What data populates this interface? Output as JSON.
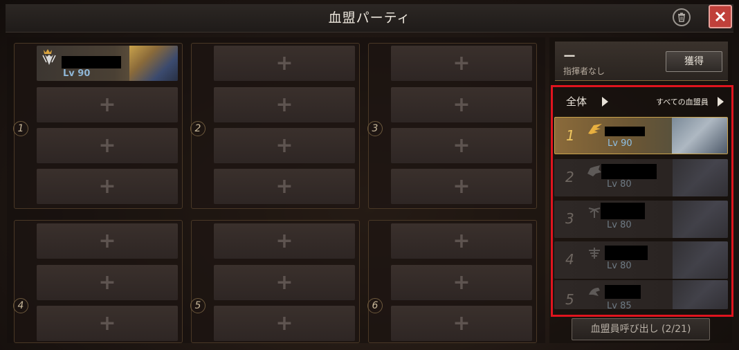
{
  "window": {
    "title": "血盟パーティ"
  },
  "parties": [
    {
      "number": "1",
      "slots": [
        {
          "filled": true,
          "level": "Lv 90"
        },
        {
          "filled": false,
          "plus": "+"
        },
        {
          "filled": false,
          "plus": "+"
        },
        {
          "filled": false,
          "plus": "+"
        }
      ]
    },
    {
      "number": "2",
      "slots": [
        {
          "filled": false,
          "plus": "+"
        },
        {
          "filled": false,
          "plus": "+"
        },
        {
          "filled": false,
          "plus": "+"
        },
        {
          "filled": false,
          "plus": "+"
        }
      ]
    },
    {
      "number": "3",
      "slots": [
        {
          "filled": false,
          "plus": "+"
        },
        {
          "filled": false,
          "plus": "+"
        },
        {
          "filled": false,
          "plus": "+"
        },
        {
          "filled": false,
          "plus": "+"
        }
      ]
    },
    {
      "number": "4",
      "slots": [
        {
          "filled": false,
          "plus": "+"
        },
        {
          "filled": false,
          "plus": "+"
        },
        {
          "filled": false,
          "plus": "+"
        }
      ]
    },
    {
      "number": "5",
      "slots": [
        {
          "filled": false,
          "plus": "+"
        },
        {
          "filled": false,
          "plus": "+"
        },
        {
          "filled": false,
          "plus": "+"
        }
      ]
    },
    {
      "number": "6",
      "slots": [
        {
          "filled": false,
          "plus": "+"
        },
        {
          "filled": false,
          "plus": "+"
        },
        {
          "filled": false,
          "plus": "+"
        }
      ]
    }
  ],
  "commander": {
    "value": "ー",
    "status": "指揮者なし",
    "acquire_label": "獲得"
  },
  "filter": {
    "all_label": "全体",
    "members_label": "すべての血盟員"
  },
  "members": [
    {
      "rank": "1",
      "level": "Lv 90",
      "emblem": "gold-wing-emblem-icon"
    },
    {
      "rank": "2",
      "level": "Lv 80",
      "emblem": "wolf-emblem-icon"
    },
    {
      "rank": "3",
      "level": "Lv 80",
      "emblem": "palm-emblem-icon"
    },
    {
      "rank": "4",
      "level": "Lv 80",
      "emblem": "wings-emblem-icon"
    },
    {
      "rank": "5",
      "level": "Lv 85",
      "emblem": "beast-emblem-icon"
    }
  ],
  "summon": {
    "label": "血盟員呼び出し (2/21)"
  },
  "colors": {
    "highlight_border": "#e0141e",
    "close_button": "#c0403a",
    "level_text": "#8fb6d6"
  }
}
